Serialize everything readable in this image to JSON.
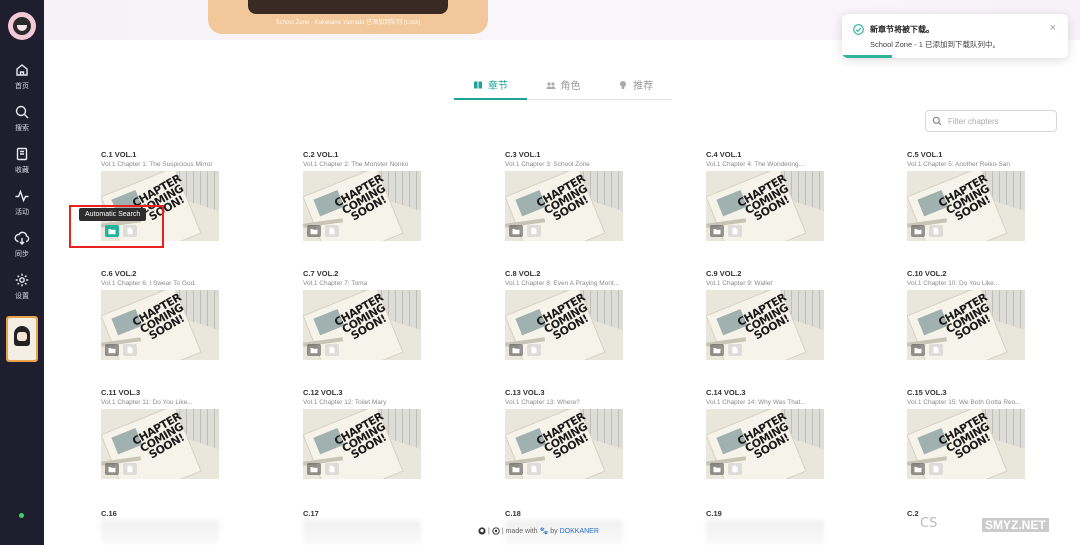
{
  "banner": {
    "caption": "School Zone - Kakelaine Yamada 已添加到队列 (Lock)"
  },
  "sidebar": {
    "items": [
      {
        "label": "首页",
        "icon": "home-icon"
      },
      {
        "label": "搜索",
        "icon": "search-icon"
      },
      {
        "label": "收藏",
        "icon": "library-icon"
      },
      {
        "label": "活动",
        "icon": "activity-icon"
      },
      {
        "label": "同步",
        "icon": "sync-icon"
      },
      {
        "label": "设置",
        "icon": "settings-icon"
      }
    ]
  },
  "tabs": [
    {
      "label": "章节",
      "icon": "book-icon",
      "active": true
    },
    {
      "label": "角色",
      "icon": "characters-icon",
      "active": false
    },
    {
      "label": "推荐",
      "icon": "lightbulb-icon",
      "active": false
    }
  ],
  "filter": {
    "placeholder": "Filter chapters",
    "value": ""
  },
  "tooltip": {
    "text": "Automatic Search"
  },
  "chapters": [
    {
      "title": "C.1 VOL.1",
      "subtitle": "Vol.1 Chapter 1: The Suspicious Mirror"
    },
    {
      "title": "C.2 VOL.1",
      "subtitle": "Vol.1 Chapter 2: The Monster Nonko"
    },
    {
      "title": "C.3 VOL.1",
      "subtitle": "Vol.1 Chapter 3: School Zone"
    },
    {
      "title": "C.4 VOL.1",
      "subtitle": "Vol.1 Chapter 4: The Wondering..."
    },
    {
      "title": "C.5 VOL.1",
      "subtitle": "Vol.1 Chapter 5: Another Reiko-San"
    },
    {
      "title": "C.6 VOL.2",
      "subtitle": "Vol.1 Chapter 6: I Swear To God."
    },
    {
      "title": "C.7 VOL.2",
      "subtitle": "Vol.1 Chapter 7: Toma"
    },
    {
      "title": "C.8 VOL.2",
      "subtitle": "Vol.1 Chapter 8: Even A Praying Mont..."
    },
    {
      "title": "C.9 VOL.2",
      "subtitle": "Vol.1 Chapter 9: Wallet"
    },
    {
      "title": "C.10 VOL.2",
      "subtitle": "Vol.1 Chapter 10: Do You Like..."
    },
    {
      "title": "C.11 VOL.3",
      "subtitle": "Vol.1 Chapter 11: Do You Like..."
    },
    {
      "title": "C.12 VOL.3",
      "subtitle": "Vol.1 Chapter 12: Toilet Mary"
    },
    {
      "title": "C.13 VOL.3",
      "subtitle": "Vol.1 Chapter 13: Where?"
    },
    {
      "title": "C.14 VOL.3",
      "subtitle": "Vol.1 Chapter 14: Why Was That..."
    },
    {
      "title": "C.15 VOL.3",
      "subtitle": "Vol.1 Chapter 15: We Both Gotta Reo..."
    }
  ],
  "thumb_text": {
    "line1": "CHAPTER",
    "line2": "COMING",
    "line3": "SOON!"
  },
  "partial_chapters": [
    "C.16",
    "C.17",
    "C.18",
    "C.19",
    "C.2"
  ],
  "footer": {
    "prefix": "| made with",
    "by": "by",
    "author": "DOKKANER"
  },
  "toast": {
    "title": "新章节将被下载。",
    "message": "School Zone - 1 已添加到下载队列中。",
    "close": "×",
    "progress": 0.22
  },
  "watermark": {
    "left": "CS",
    "site": "SMYZ.NET"
  },
  "colors": {
    "accent": "#1fa39a",
    "sidebar": "#1e1e2e",
    "highlight": "#e8231f"
  }
}
